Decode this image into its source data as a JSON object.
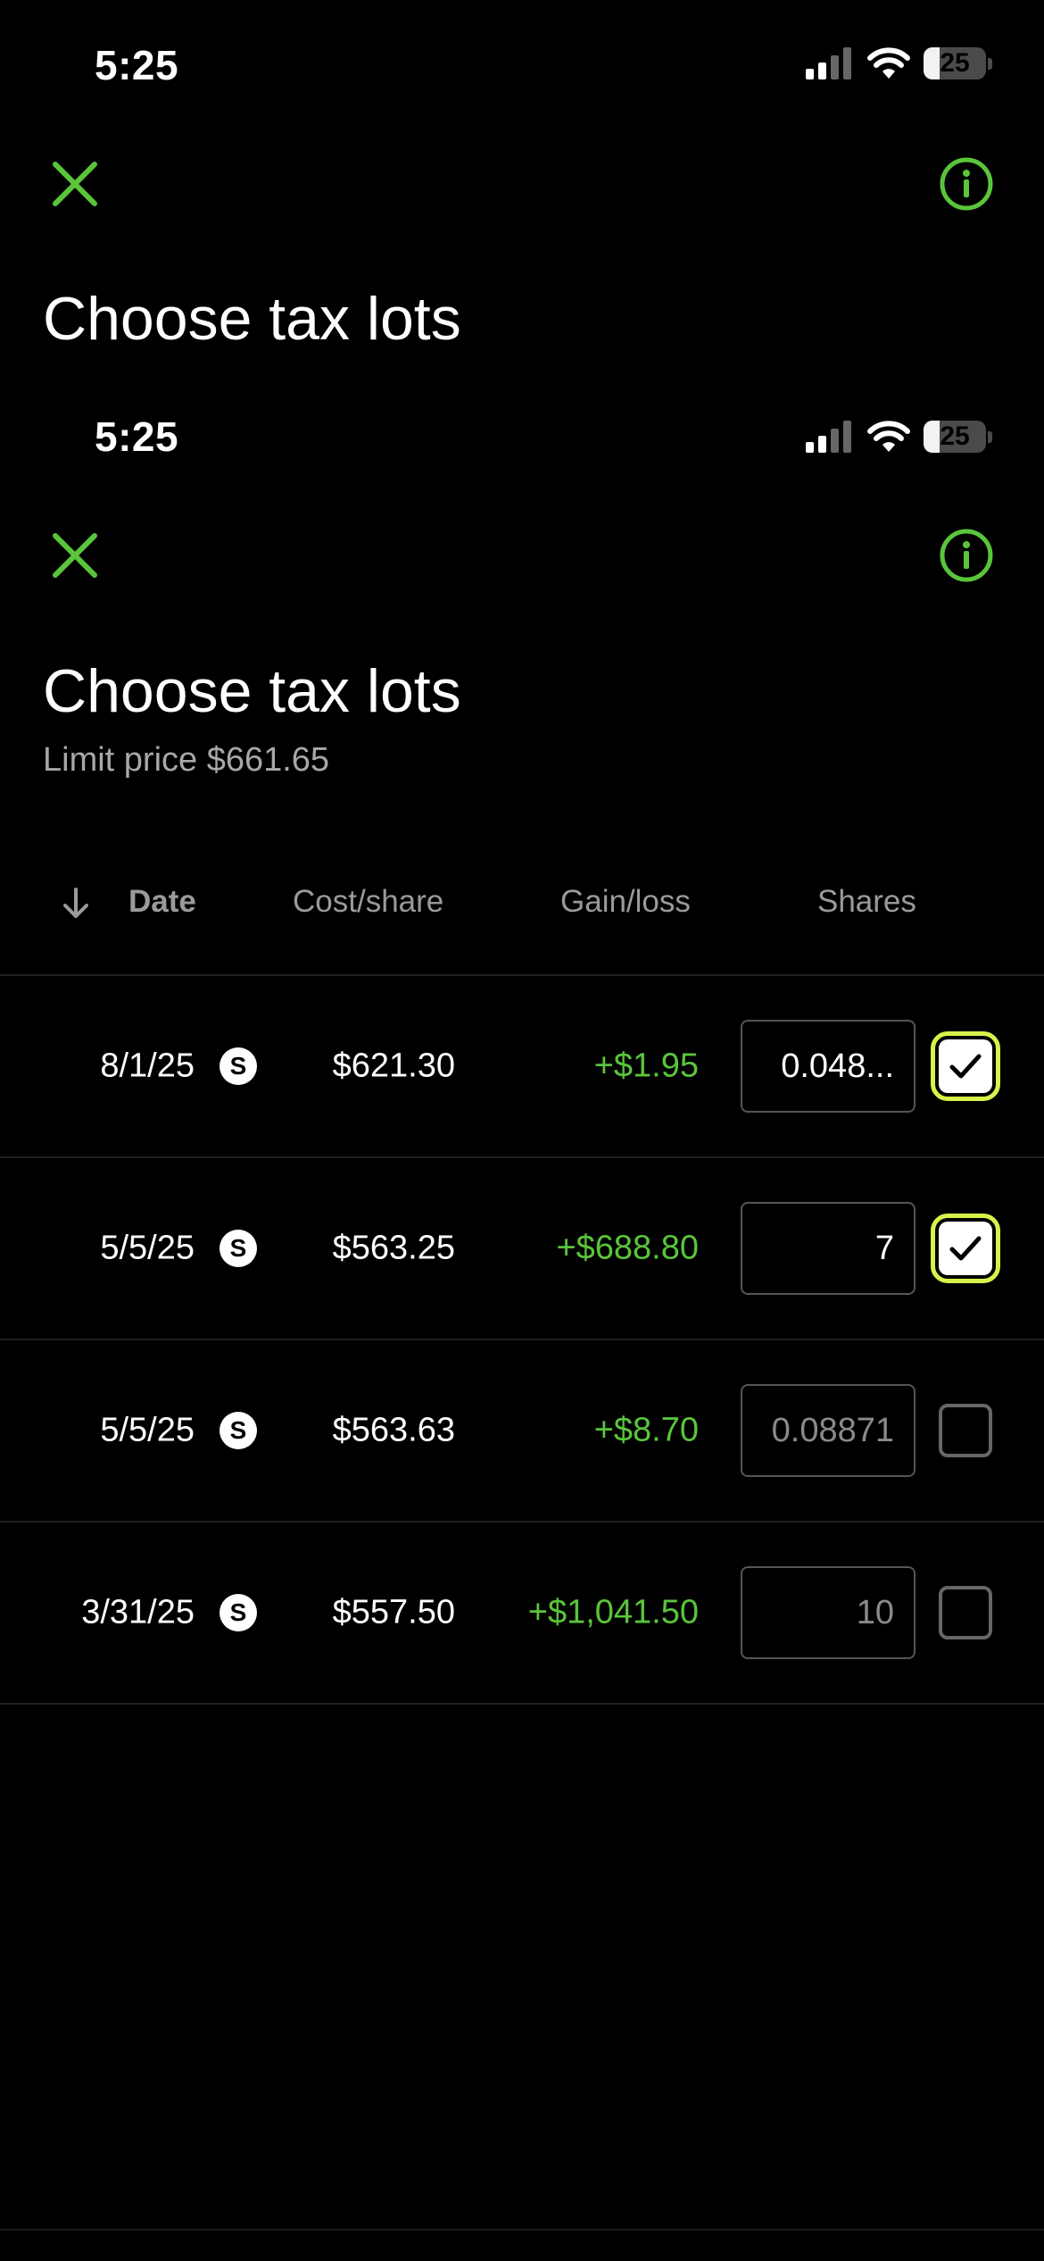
{
  "status_bar": {
    "time": "5:25",
    "battery": "25"
  },
  "header": {
    "title": "Choose tax lots"
  },
  "duplicate_status_bar": {
    "time": "5:25",
    "battery": "25"
  },
  "duplicate_header": {
    "title": "Choose tax lots",
    "subtitle": "Limit price $661.65"
  },
  "colors": {
    "accent": "#5ac53b",
    "highlight": "#d9f24a",
    "background": "#000000"
  },
  "icons": {
    "close": "close-icon",
    "info": "info-icon",
    "sort": "arrow-down-icon"
  },
  "table": {
    "columns": {
      "date": "Date",
      "cost": "Cost/share",
      "gain": "Gain/loss",
      "shares": "Shares"
    },
    "rows": [
      {
        "date": "8/1/25",
        "badge": "S",
        "cost": "$621.30",
        "gain": "+$1.95",
        "shares": "0.048...",
        "checked": true
      },
      {
        "date": "5/5/25",
        "badge": "S",
        "cost": "$563.25",
        "gain": "+$688.80",
        "shares": "7",
        "checked": true
      },
      {
        "date": "5/5/25",
        "badge": "S",
        "cost": "$563.63",
        "gain": "+$8.70",
        "shares": "0.08871",
        "checked": false
      },
      {
        "date": "3/31/25",
        "badge": "S",
        "cost": "$557.50",
        "gain": "+$1,041.50",
        "shares": "10",
        "checked": false
      }
    ]
  }
}
